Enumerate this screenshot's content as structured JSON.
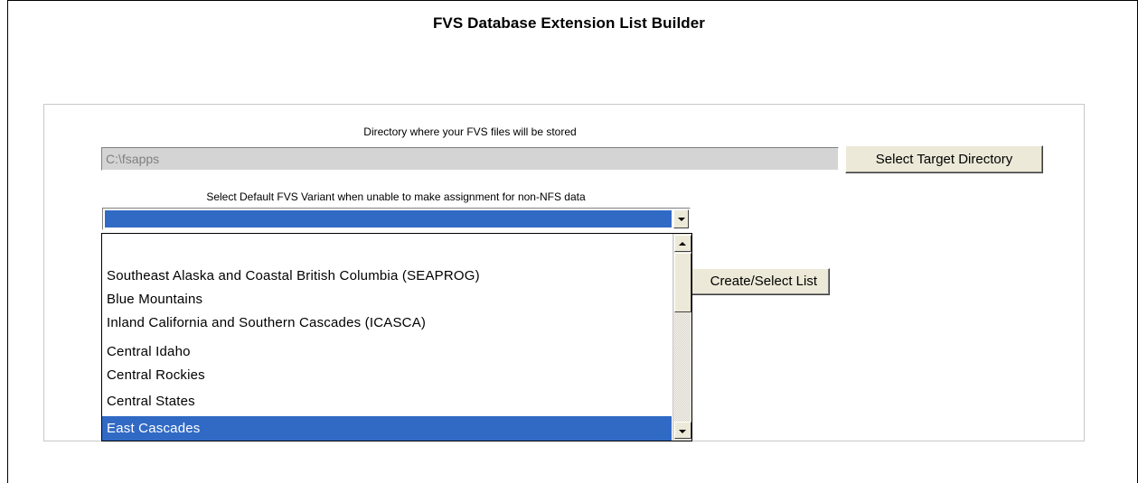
{
  "window": {
    "title": "FVS Database Extension List Builder"
  },
  "directory": {
    "label": "Directory where your FVS files will be stored",
    "value": "C:\\fsapps",
    "select_button_label": "Select Target Directory"
  },
  "variant": {
    "label": "Select Default FVS Variant when unable to make assignment for non-NFS data",
    "selected_value": "",
    "options": [
      "",
      "Southeast Alaska and Coastal British Columbia (SEAPROG)",
      "Blue Mountains",
      "Inland California and Southern Cascades (ICASCA)",
      "Central Idaho",
      "Central Rockies",
      "Central States",
      "East Cascades"
    ],
    "highlighted_option": "East Cascades"
  },
  "actions": {
    "create_list_label": "Create/Select List"
  },
  "colors": {
    "selection": "#316ac5",
    "button_face": "#ece9d8",
    "disabled_field": "#d4d4d4"
  }
}
